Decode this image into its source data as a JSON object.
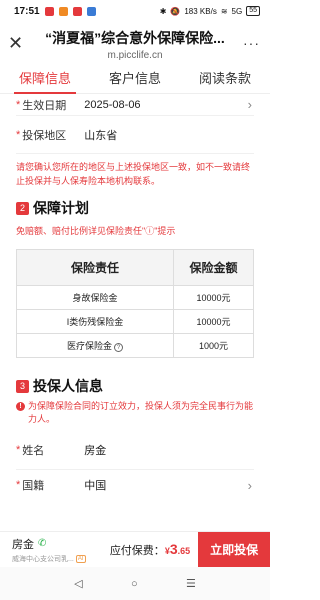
{
  "status_bar": {
    "time": "17:51",
    "network": "183 KB/s",
    "signal": "5G",
    "battery": "55"
  },
  "header": {
    "title": "“消夏福”综合意外保障保险...",
    "url": "m.picclife.cn",
    "more": "···"
  },
  "tabs": [
    {
      "label": "保障信息"
    },
    {
      "label": "客户信息"
    },
    {
      "label": "阅读条款"
    }
  ],
  "policy": {
    "effective_date_label": "生效日期",
    "effective_date_value": "2025-08-06",
    "region_label": "投保地区",
    "region_value": "山东省",
    "notice": "请您确认您所在的地区与上述投保地区一致，如不一致请终止投保并与人保寿险本地机构联系。"
  },
  "section2": {
    "num": "2",
    "title": "保障计划",
    "subtitle": "免赔额、赔付比例详见保险责任\"ⓘ\"提示",
    "table": {
      "headers": [
        "保险责任",
        "保险金额"
      ],
      "rows": [
        {
          "name": "身故保险金",
          "amount": "10000元"
        },
        {
          "name": "I类伤残保险金",
          "amount": "10000元"
        },
        {
          "name": "医疗保险金",
          "amount": "1000元"
        }
      ],
      "help_glyph": "?"
    }
  },
  "section3": {
    "num": "3",
    "title": "投保人信息",
    "note": "为保障保险合同的订立效力，投保人须为完全民事行为能力人。",
    "name_label": "姓名",
    "name_value": "房金",
    "nationality_label": "国籍",
    "nationality_value": "中国"
  },
  "bottom_bar": {
    "agent_name": "房金",
    "agent_company": "威海中心支公司乳...",
    "ai_tag": "AI",
    "fee_label": "应付保费：",
    "fee_currency": "¥",
    "fee_int": "3",
    "fee_dec": ".65",
    "buy_label": "立即投保"
  },
  "nav": {
    "back": "◁",
    "home": "○",
    "menu": "☰"
  },
  "colors": {
    "accent": "#e4393c",
    "phone": "#2bb24c"
  }
}
